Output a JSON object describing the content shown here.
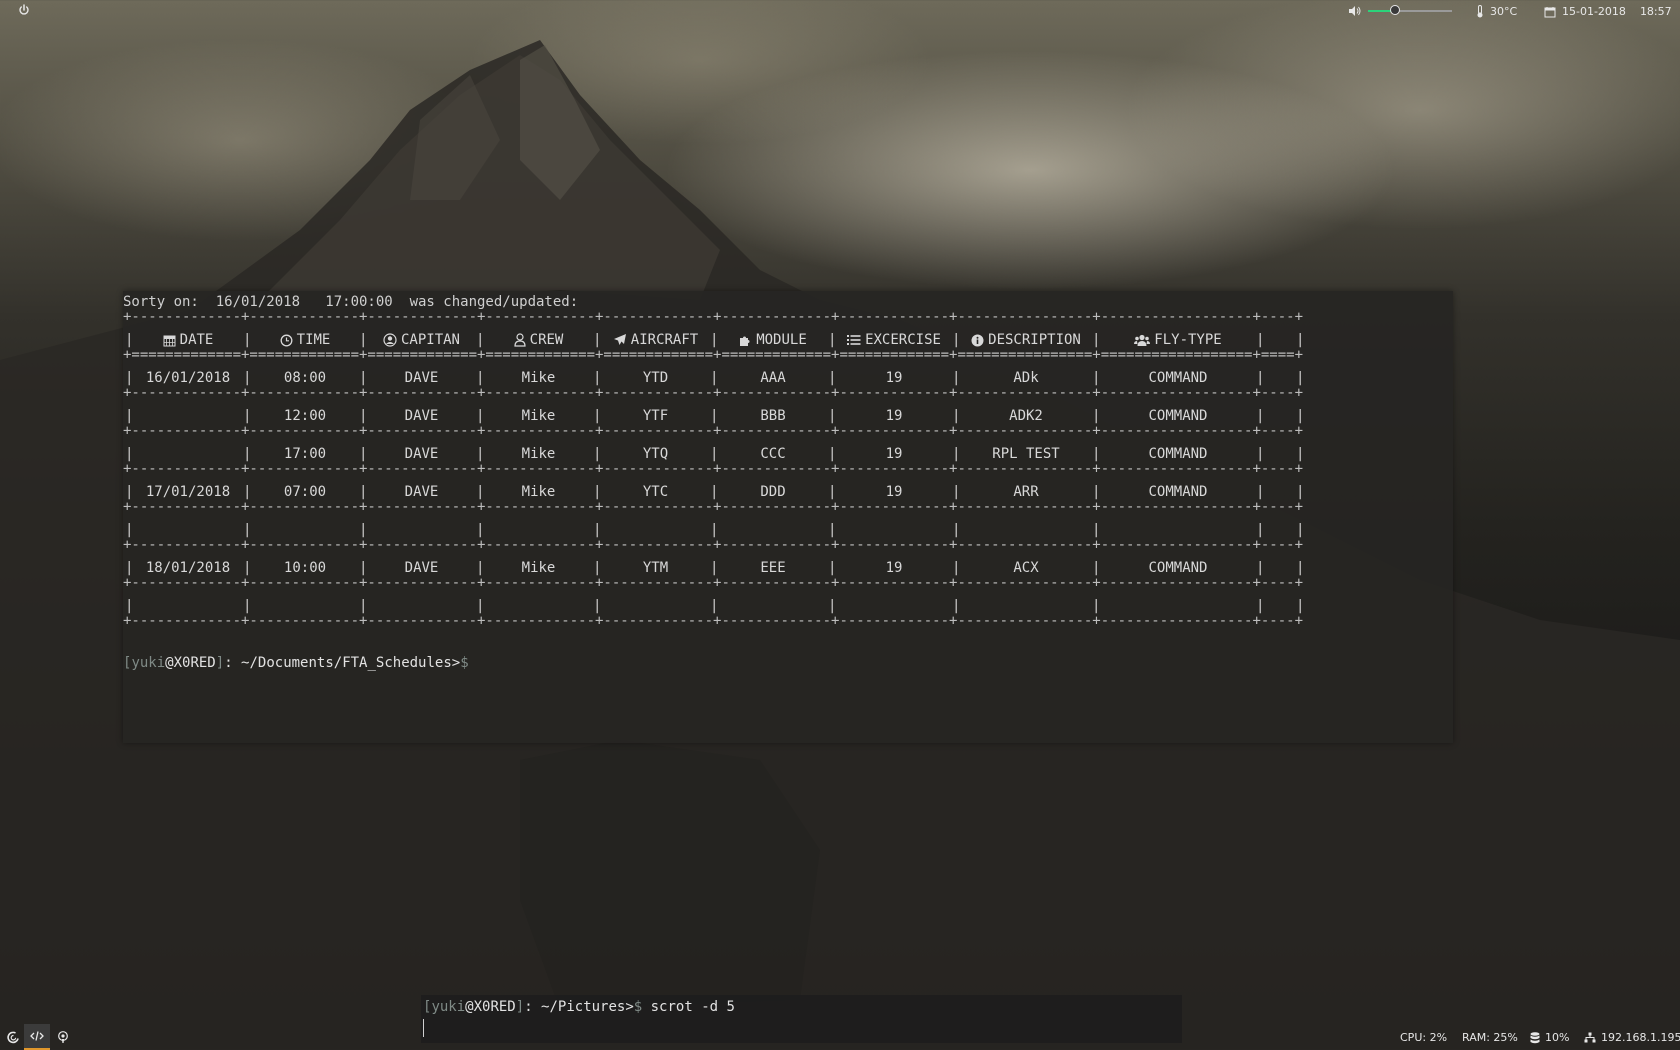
{
  "topbar": {
    "power_icon": "power-icon",
    "volume_icon": "volume-icon",
    "volume_level": 0.32,
    "slider_fill_color": "#2bd37a",
    "temperature": "30°C",
    "date": "15-01-2018",
    "time": "18:57"
  },
  "terminal": {
    "notice": "Sorty on:  16/01/2018   17:00:00  was changed/updated:",
    "headers": [
      {
        "label": "DATE",
        "icon": "calendar-icon"
      },
      {
        "label": "TIME",
        "icon": "clock-icon"
      },
      {
        "label": "CAPITAN",
        "icon": "user-circle-icon"
      },
      {
        "label": "CREW",
        "icon": "user-icon"
      },
      {
        "label": "AIRCRAFT",
        "icon": "plane-icon"
      },
      {
        "label": "MODULE",
        "icon": "puzzle-icon"
      },
      {
        "label": "EXCERCISE",
        "icon": "list-icon"
      },
      {
        "label": "DESCRIPTION",
        "icon": "info-icon"
      },
      {
        "label": "FLY-TYPE",
        "icon": "users-icon"
      }
    ],
    "rows": [
      [
        "16/01/2018",
        "08:00",
        "DAVE",
        "Mike",
        "YTD",
        "AAA",
        "19",
        "ADk",
        "COMMAND"
      ],
      [
        "",
        "12:00",
        "DAVE",
        "Mike",
        "YTF",
        "BBB",
        "19",
        "ADK2",
        "COMMAND"
      ],
      [
        "",
        "17:00",
        "DAVE",
        "Mike",
        "YTQ",
        "CCC",
        "19",
        "RPL TEST",
        "COMMAND"
      ],
      [
        "17/01/2018",
        "07:00",
        "DAVE",
        "Mike",
        "YTC",
        "DDD",
        "19",
        "ARR",
        "COMMAND"
      ],
      [
        "",
        "",
        "",
        "",
        "",
        "",
        "",
        "",
        ""
      ],
      [
        "18/01/2018",
        "10:00",
        "DAVE",
        "Mike",
        "YTM",
        "EEE",
        "19",
        "ACX",
        "COMMAND"
      ],
      [
        "",
        "",
        "",
        "",
        "",
        "",
        "",
        "",
        ""
      ]
    ],
    "prompt": {
      "open": "[",
      "user": "yuki",
      "at": "@",
      "host": "X0RED",
      "close": "]",
      "path": ": ~/Documents/FTA_Schedules>",
      "dollar": "$"
    }
  },
  "miniterm": {
    "prompt": {
      "open": "[",
      "user": "yuki",
      "at": "@",
      "host": "X0RED",
      "close": "]",
      "path": ": ~/Pictures>",
      "dollar": "$"
    },
    "command": " scrot -d 5"
  },
  "bottombar": {
    "launchers": [
      "debian-icon",
      "code-icon",
      "podcast-icon"
    ],
    "active_color": "#e0972c",
    "cpu": "CPU: 2%",
    "ram": "RAM: 25%",
    "disk": "10%",
    "ip": "192.168.1.195"
  }
}
